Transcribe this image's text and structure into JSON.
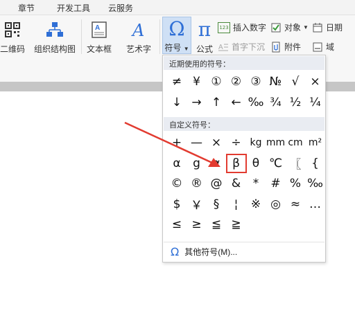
{
  "tabs": [
    "章节",
    "开发工具",
    "云服务"
  ],
  "ribbon": {
    "qr_label": "二维码",
    "orgchart_label": "组织结构图",
    "textbox_label": "文本框",
    "wordart_label": "艺术字",
    "symbol_label": "符号",
    "formula_label": "公式",
    "insert_number_label": "插入数字",
    "object_label": "对象",
    "date_label": "日期",
    "dropcap_label": "首字下沉",
    "attachment_label": "附件",
    "field_label": "域",
    "number_badge": "123"
  },
  "symbol_panel": {
    "recent_header": "近期使用的符号：",
    "recent_symbols": [
      "≠",
      "¥",
      "①",
      "②",
      "③",
      "№",
      "√",
      "×",
      "↓",
      "→",
      "↑",
      "←",
      "‰",
      "¾",
      "½",
      "¼"
    ],
    "custom_header": "自定义符号：",
    "custom_symbols": [
      "+",
      "—",
      "×",
      "÷",
      "kg",
      "mm",
      "cm",
      "m²",
      "α",
      "g",
      "α",
      "β",
      "θ",
      "℃",
      "〖",
      "{",
      "©",
      "®",
      "@",
      "&",
      "*",
      "#",
      "%",
      "‰",
      "$",
      "￥",
      "§",
      "¦",
      "※",
      "◎",
      "≈",
      "…",
      "≤",
      "≥",
      "≦",
      "≧"
    ],
    "selected_symbol": "β",
    "more_label": "其他符号(M)...",
    "more_icon": "Ω"
  },
  "colors": {
    "highlight": "#e23b30",
    "accent_blue": "#2f6fd6"
  }
}
